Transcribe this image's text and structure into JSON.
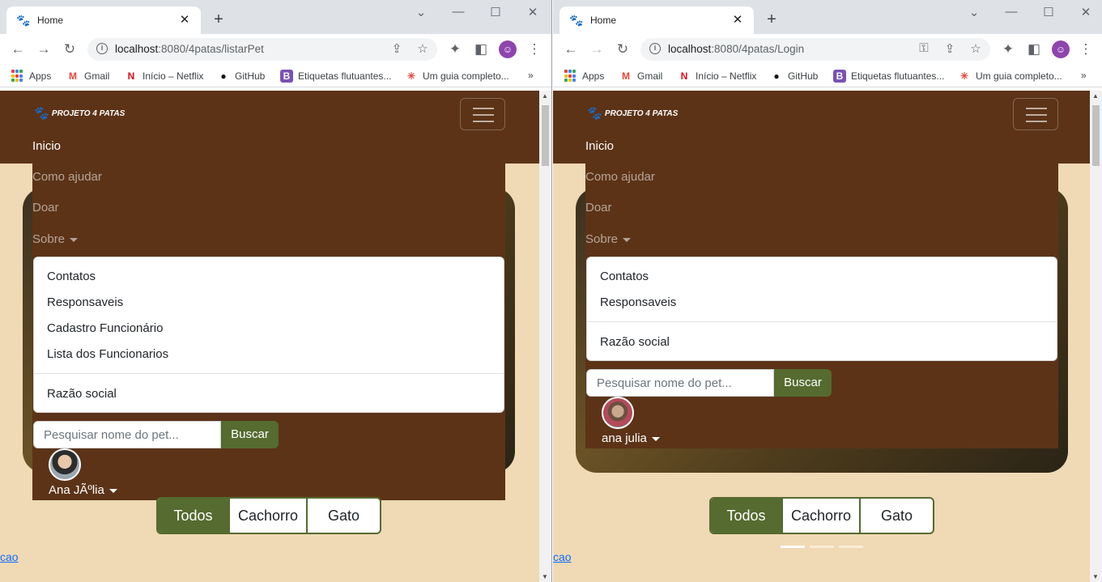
{
  "left": {
    "tab": {
      "title": "Home",
      "close": "✕"
    },
    "new_tab": "+",
    "window_controls": {
      "minimize": "—",
      "maximize": "☐",
      "close": "✕",
      "dropdown": "⌄"
    },
    "url": {
      "host": "localhost",
      "path": ":8080/4patas/listarPet"
    },
    "bookmarks": [
      "Apps",
      "Gmail",
      "Início – Netflix",
      "GitHub",
      "Etiquetas flutuantes...",
      "Um guia completo..."
    ],
    "bookmarks_more": "»",
    "site": {
      "logo_text": "PROJETO 4 PATAS",
      "nav": {
        "inicio": "Inicio",
        "como_ajudar": "Como ajudar",
        "doar": "Doar",
        "sobre": "Sobre"
      },
      "dropdown": [
        "Contatos",
        "Responsaveis",
        "Cadastro Funcionário",
        "Lista dos Funcionarios"
      ],
      "dropdown_last": "Razão social",
      "search": {
        "placeholder": "Pesquisar nome do pet...",
        "button": "Buscar"
      },
      "user_name": "Ana JÃºlia",
      "filters": [
        "Todos",
        "Cachorro",
        "Gato"
      ],
      "link": "cao"
    }
  },
  "right": {
    "tab": {
      "title": "Home",
      "close": "✕"
    },
    "new_tab": "+",
    "window_controls": {
      "minimize": "—",
      "maximize": "☐",
      "close": "✕",
      "dropdown": "⌄"
    },
    "url": {
      "host": "localhost",
      "path": ":8080/4patas/Login"
    },
    "bookmarks": [
      "Apps",
      "Gmail",
      "Início – Netflix",
      "GitHub",
      "Etiquetas flutuantes...",
      "Um guia completo..."
    ],
    "bookmarks_more": "»",
    "site": {
      "logo_text": "PROJETO 4 PATAS",
      "nav": {
        "inicio": "Inicio",
        "como_ajudar": "Como ajudar",
        "doar": "Doar",
        "sobre": "Sobre"
      },
      "dropdown": [
        "Contatos",
        "Responsaveis"
      ],
      "dropdown_last": "Razão social",
      "search": {
        "placeholder": "Pesquisar nome do pet...",
        "button": "Buscar"
      },
      "user_name": "ana julia",
      "filters": [
        "Todos",
        "Cachorro",
        "Gato"
      ],
      "link": "cao"
    }
  },
  "colors": {
    "brown": "#5c3317",
    "beige": "#f0d9b5",
    "olive": "#556b2f"
  }
}
